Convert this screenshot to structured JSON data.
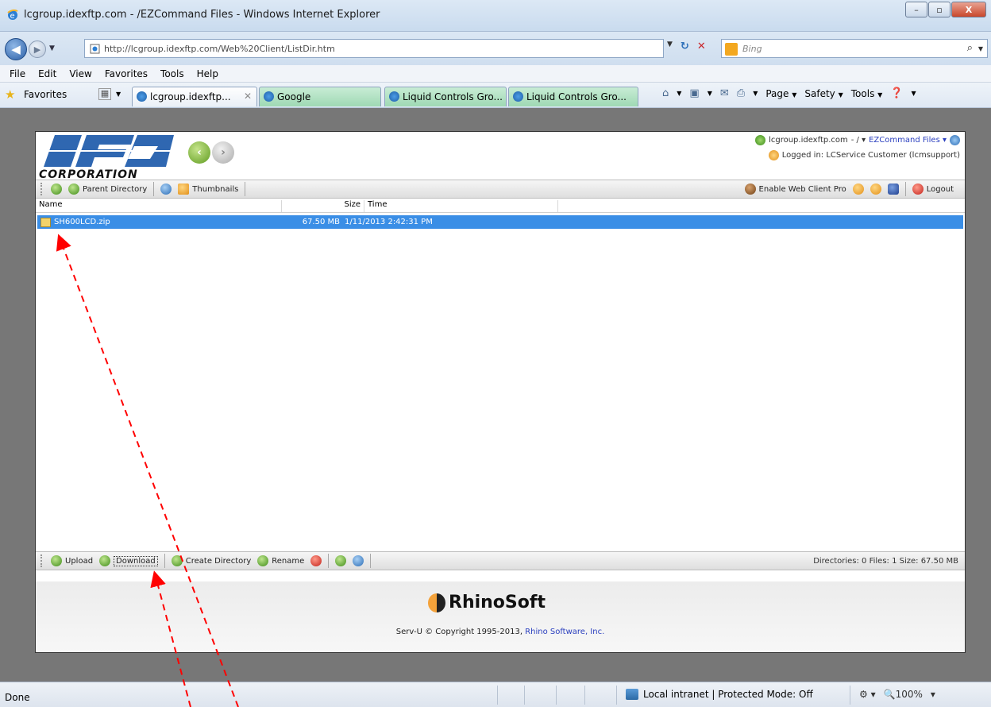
{
  "window": {
    "title": "lcgroup.idexftp.com - /EZCommand Files - Windows Internet Explorer",
    "minimize_label": "–",
    "maximize_label": "▫",
    "close_label": "X"
  },
  "address_bar": {
    "url": "http://lcgroup.idexftp.com/Web%20Client/ListDir.htm",
    "search_placeholder": "Bing"
  },
  "menu": [
    "File",
    "Edit",
    "View",
    "Favorites",
    "Tools",
    "Help"
  ],
  "favorites_bar": {
    "favorites_label": "Favorites",
    "tabs": [
      {
        "label": "lcgroup.idexftp...",
        "active": true
      },
      {
        "label": "Google",
        "active": false
      },
      {
        "label": "Liquid Controls Gro...",
        "active": false
      },
      {
        "label": "Liquid Controls Gro...",
        "active": false
      }
    ],
    "commands": [
      "Page",
      "Safety",
      "Tools"
    ]
  },
  "web_client": {
    "logo_text": "CORPORATION",
    "host": "lcgroup.idexftp.com",
    "path_sep": "- / ▾",
    "folder_link": "EZCommand Files ▾",
    "logged_in": "Logged in: LCService Customer (lcmsupport)",
    "top_toolbar": {
      "parent_directory": "Parent Directory",
      "thumbnails": "Thumbnails",
      "enable_pro": "Enable Web Client Pro",
      "logout": "Logout"
    },
    "columns": [
      "Name",
      "Size",
      "Time"
    ],
    "files": [
      {
        "name": "SH600LCD.zip",
        "size": "67.50 MB",
        "time": "1/11/2013 2:42:31 PM"
      }
    ],
    "bottom_toolbar": {
      "upload": "Upload",
      "download": "Download",
      "create_directory": "Create Directory",
      "rename": "Rename"
    },
    "summary": "Directories: 0   Files: 1   Size: 67.50 MB",
    "footer_brand": "RhinoSoft",
    "copyright_prefix": "Serv-U © Copyright 1995-2013, ",
    "copyright_link": "Rhino Software, Inc."
  },
  "status_bar": {
    "status": "Done",
    "zone": "Local intranet | Protected Mode: Off",
    "zoom": "100%"
  },
  "colors": {
    "selection": "#3a8ee6",
    "annotation_arrow": "#ff0000",
    "background_gray": "#777777"
  }
}
